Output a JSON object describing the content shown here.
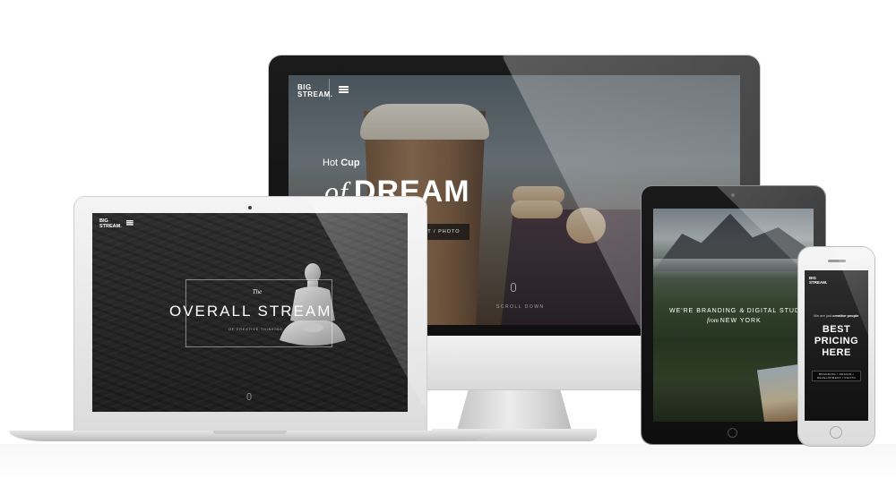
{
  "brand": {
    "logo_line1": "BIG",
    "logo_line2": "STREAM."
  },
  "desktop": {
    "tagline_regular": "Hot ",
    "tagline_bold": "Cup",
    "headline_script": "of",
    "headline_main": "DREAM",
    "categories": "MENT / PHOTO",
    "scroll_label": "SCROLL DOWN"
  },
  "laptop": {
    "pre_title": "The",
    "title": "OVERALL STREAM",
    "subtitle": "OF CREATIVE THINKING",
    "scroll_label": "SCROLL"
  },
  "tablet": {
    "line1_a": "WE'RE BRANDING ",
    "line1_amp": "&",
    "line1_b": " DIGITAL STUDIO",
    "line2_from": "from ",
    "line2_city": "NEW YORK"
  },
  "phone": {
    "tag_regular": "We are just ",
    "tag_bold": "creative people",
    "headline_1": "BEST",
    "headline_2": "PRICING",
    "headline_3": "HERE",
    "services_1": "BRANDING / DESIGN /",
    "services_2": "DEVELOPMENT / PHOTO"
  },
  "colors": {
    "device_dark": "#111111",
    "device_silver": "#e0e0e0",
    "text_light": "#ffffff"
  },
  "icons": {
    "menu": "hamburger-menu-icon",
    "scroll": "mouse-scroll-icon"
  }
}
